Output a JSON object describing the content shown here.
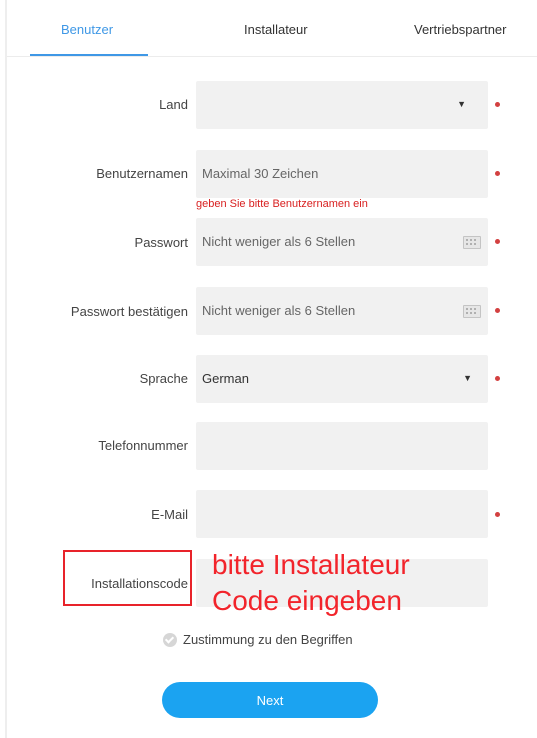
{
  "tabs": [
    {
      "label": "Benutzer",
      "active": true
    },
    {
      "label": "Installateur",
      "active": false
    },
    {
      "label": "Vertriebspartner",
      "active": false
    }
  ],
  "form": {
    "country": {
      "label": "Land",
      "value": "",
      "required": true
    },
    "username": {
      "label": "Benutzernamen",
      "placeholder": "Maximal 30 Zeichen",
      "required": true,
      "error": "geben Sie bitte Benutzernamen ein"
    },
    "password": {
      "label": "Passwort",
      "placeholder": "Nicht weniger als 6 Stellen",
      "required": true
    },
    "password_confirm": {
      "label": "Passwort bestätigen",
      "placeholder": "Nicht weniger als 6 Stellen",
      "required": true
    },
    "language": {
      "label": "Sprache",
      "value": "German",
      "required": true
    },
    "phone": {
      "label": "Telefonnummer",
      "value": "",
      "required": false
    },
    "email": {
      "label": "E-Mail",
      "value": "",
      "required": true
    },
    "install_code": {
      "label": "Installationscode",
      "value": "",
      "required": false
    }
  },
  "annotation": {
    "line1": "bitte Installateur",
    "line2": "Code eingeben",
    "color": "#f2242b"
  },
  "agreement": {
    "label": "Zustimmung zu den Begriffen"
  },
  "next_label": "Next",
  "colors": {
    "accent": "#3f98e6",
    "button": "#1ba3f1",
    "required_dot": "#d34040",
    "error": "#d82020"
  }
}
